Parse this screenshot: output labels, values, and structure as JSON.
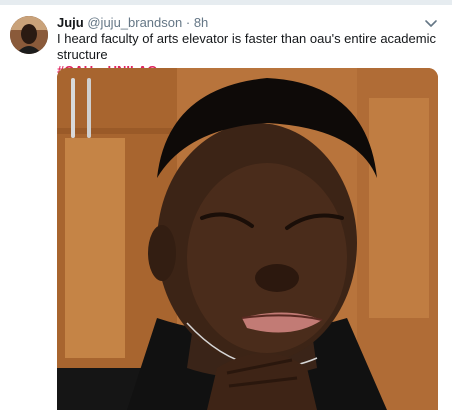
{
  "tweet": {
    "author_name": "Juju",
    "author_handle": "@juju_brandson",
    "separator": "·",
    "timestamp": "8h",
    "text": "I heard faculty of arts elevator is faster than oau's entire academic structure",
    "hashtag": "#OAUvsUNILAG",
    "menu_icon": "chevron-down-icon"
  },
  "colors": {
    "hashtag": "#e0245e",
    "name": "#14171a",
    "meta": "#657786"
  }
}
